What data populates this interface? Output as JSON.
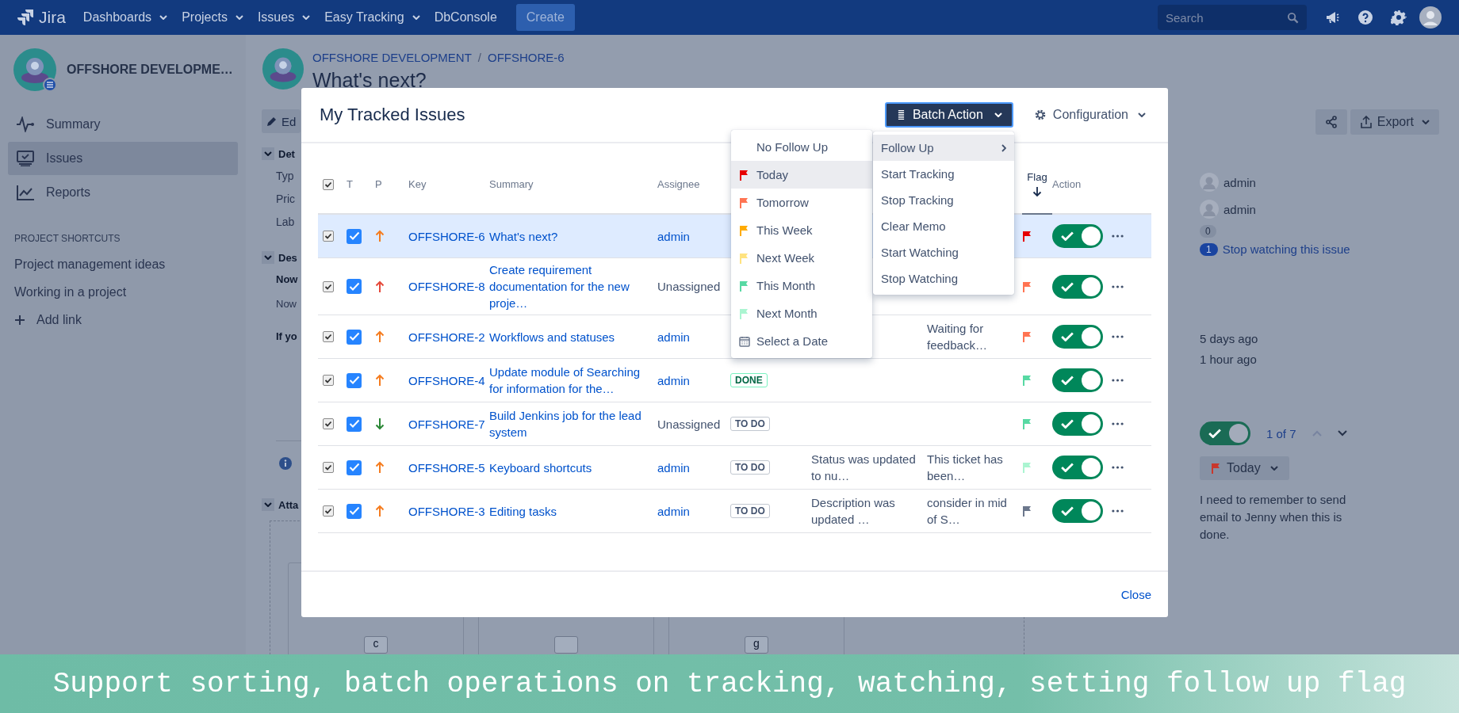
{
  "top_nav": {
    "logo": "Jira",
    "menus": [
      {
        "label": "Dashboards",
        "dropdown": true
      },
      {
        "label": "Projects",
        "dropdown": true
      },
      {
        "label": "Issues",
        "dropdown": true
      },
      {
        "label": "Easy Tracking",
        "dropdown": true
      },
      {
        "label": "DbConsole",
        "dropdown": false
      }
    ],
    "create_button": "Create",
    "search": {
      "placeholder": "Search"
    }
  },
  "sidebar": {
    "project_name": "OFFSHORE DEVELOPME…",
    "items": [
      {
        "label": "Summary",
        "selected": false
      },
      {
        "label": "Issues",
        "selected": true
      },
      {
        "label": "Reports",
        "selected": false
      }
    ],
    "shortcuts_heading": "PROJECT SHORTCUTS",
    "shortcuts": [
      "Project management ideas",
      "Working in a project"
    ],
    "add_link": "Add link"
  },
  "issue": {
    "breadcrumbs": [
      "OFFSHORE DEVELOPMENT",
      "OFFSHORE-6"
    ],
    "breadcrumb_separator": "/",
    "title": "What's next?",
    "edit_button": "Ed",
    "details": {
      "heading": "Det",
      "fields": [
        "Typ",
        "Pric",
        "Lab"
      ]
    },
    "description": {
      "heading": "Des",
      "lines": [
        {
          "text": "Now",
          "bold": true
        },
        {
          "text": "Now",
          "bold": false
        },
        {
          "text": "If yo",
          "bold": true
        }
      ]
    },
    "attachments": {
      "heading": "Atta",
      "files": [
        {
          "kind": "labeled",
          "label": "c"
        },
        {
          "kind": "blank"
        },
        {
          "kind": "labeled",
          "label": "g"
        }
      ]
    },
    "export_button": "Export",
    "people": [
      "admin",
      "admin"
    ],
    "votes": "0",
    "watchers": {
      "count": "1",
      "link": "Stop watching this issue"
    },
    "dates": [
      "5 days ago",
      "1 hour ago"
    ],
    "tracking": {
      "on": true,
      "position": "1 of 7"
    },
    "follow_up": {
      "label": "Today",
      "color": "#c9372c"
    },
    "memo": "I need to remember to send email to Jenny when this is done."
  },
  "modal": {
    "title": "My Tracked Issues",
    "batch_button": "Batch Action",
    "config_button": "Configuration",
    "select_all": {
      "checked": true
    },
    "columns": [
      {
        "kind": "type",
        "label": "T",
        "sorted": false
      },
      {
        "kind": "priority",
        "label": "P",
        "sorted": false
      },
      {
        "kind": "key",
        "label": "Key",
        "sorted": false
      },
      {
        "kind": "summary",
        "label": "Summary",
        "sorted": false
      },
      {
        "kind": "assignee",
        "label": "Assignee",
        "sorted": false
      },
      {
        "kind": "flag",
        "label": "Flag",
        "sorted": true
      },
      {
        "kind": "action",
        "label": "Action",
        "sorted": false
      }
    ],
    "rows": [
      {
        "selected": true,
        "checked": true,
        "tracked": true,
        "priority": {
          "kind": "high"
        },
        "key": "OFFSHORE-6",
        "summary": "What's next?",
        "assignee": "admin",
        "assigned": true,
        "flag": {
          "color": "#e60000"
        },
        "on": true
      },
      {
        "selected": false,
        "checked": true,
        "tracked": true,
        "priority": {
          "kind": "highest"
        },
        "key": "OFFSHORE-8",
        "summary": "Create requirement documentation for the new proje…",
        "assignee": "Unassigned",
        "assigned": false,
        "flag": {
          "color": "#ff7452"
        },
        "on": true
      },
      {
        "selected": false,
        "checked": true,
        "tracked": true,
        "priority": {
          "kind": "high"
        },
        "key": "OFFSHORE-2",
        "summary": "Workflows and statuses",
        "assignee": "admin",
        "assigned": true,
        "column_8": "Waiting for feedback…",
        "flag": {
          "color": "#ff7452"
        },
        "on": true
      },
      {
        "selected": false,
        "checked": true,
        "tracked": true,
        "priority": {
          "kind": "high"
        },
        "key": "OFFSHORE-4",
        "summary": "Update module of Searching for information for the…",
        "assignee": "admin",
        "assigned": true,
        "status": {
          "label": "DONE",
          "kind": "done"
        },
        "flag": {
          "color": "#57d9a3"
        },
        "on": true
      },
      {
        "selected": false,
        "checked": true,
        "tracked": true,
        "priority": {
          "kind": "low"
        },
        "key": "OFFSHORE-7",
        "summary": "Build Jenkins job for the lead system",
        "assignee": "Unassigned",
        "assigned": false,
        "status": {
          "label": "TO DO",
          "kind": "todo"
        },
        "flag": {
          "color": "#57d9a3"
        },
        "on": true
      },
      {
        "selected": false,
        "checked": true,
        "tracked": true,
        "priority": {
          "kind": "high"
        },
        "key": "OFFSHORE-5",
        "summary": "Keyboard shortcuts",
        "assignee": "admin",
        "assigned": true,
        "status": {
          "label": "TO DO",
          "kind": "todo"
        },
        "column_7": "Status was updated to nu…",
        "column_8": "This ticket has been…",
        "flag": {
          "color": "#abf5d1"
        },
        "on": true
      },
      {
        "selected": false,
        "checked": true,
        "tracked": true,
        "priority": {
          "kind": "high"
        },
        "key": "OFFSHORE-3",
        "summary": "Editing tasks",
        "assignee": "admin",
        "assigned": true,
        "status": {
          "label": "TO DO",
          "kind": "todo"
        },
        "column_7": "Description was updated …",
        "column_8": "consider in mid of S…",
        "flag": {
          "color": "#6b778c"
        },
        "on": true
      }
    ],
    "close_link": "Close"
  },
  "batch_menu": {
    "items": [
      {
        "label": "Follow Up",
        "submenu": true,
        "selected": true
      },
      {
        "label": "Start Tracking",
        "submenu": false,
        "selected": false
      },
      {
        "label": "Stop Tracking",
        "submenu": false,
        "selected": false
      },
      {
        "label": "Clear Memo",
        "submenu": false,
        "selected": false
      },
      {
        "label": "Start Watching",
        "submenu": false,
        "selected": false
      },
      {
        "label": "Stop Watching",
        "submenu": false,
        "selected": false
      }
    ]
  },
  "follow_up_menu": {
    "items": [
      {
        "label": "No Follow Up",
        "kind": "none",
        "selected": false
      },
      {
        "label": "Today",
        "kind": "flag",
        "color": "#e60000",
        "selected": true
      },
      {
        "label": "Tomorrow",
        "kind": "flag",
        "color": "#ff7452",
        "selected": false
      },
      {
        "label": "This Week",
        "kind": "flag",
        "color": "#ffab00",
        "selected": false
      },
      {
        "label": "Next Week",
        "kind": "flag",
        "color": "#ffe380",
        "selected": false
      },
      {
        "label": "This Month",
        "kind": "flag",
        "color": "#57d9a3",
        "selected": false
      },
      {
        "label": "Next Month",
        "kind": "flag",
        "color": "#abf5d1",
        "selected": false
      },
      {
        "label": "Select a Date",
        "kind": "date",
        "selected": false
      }
    ]
  },
  "caption": "Support sorting, batch operations on tracking, watching, setting follow up flag"
}
